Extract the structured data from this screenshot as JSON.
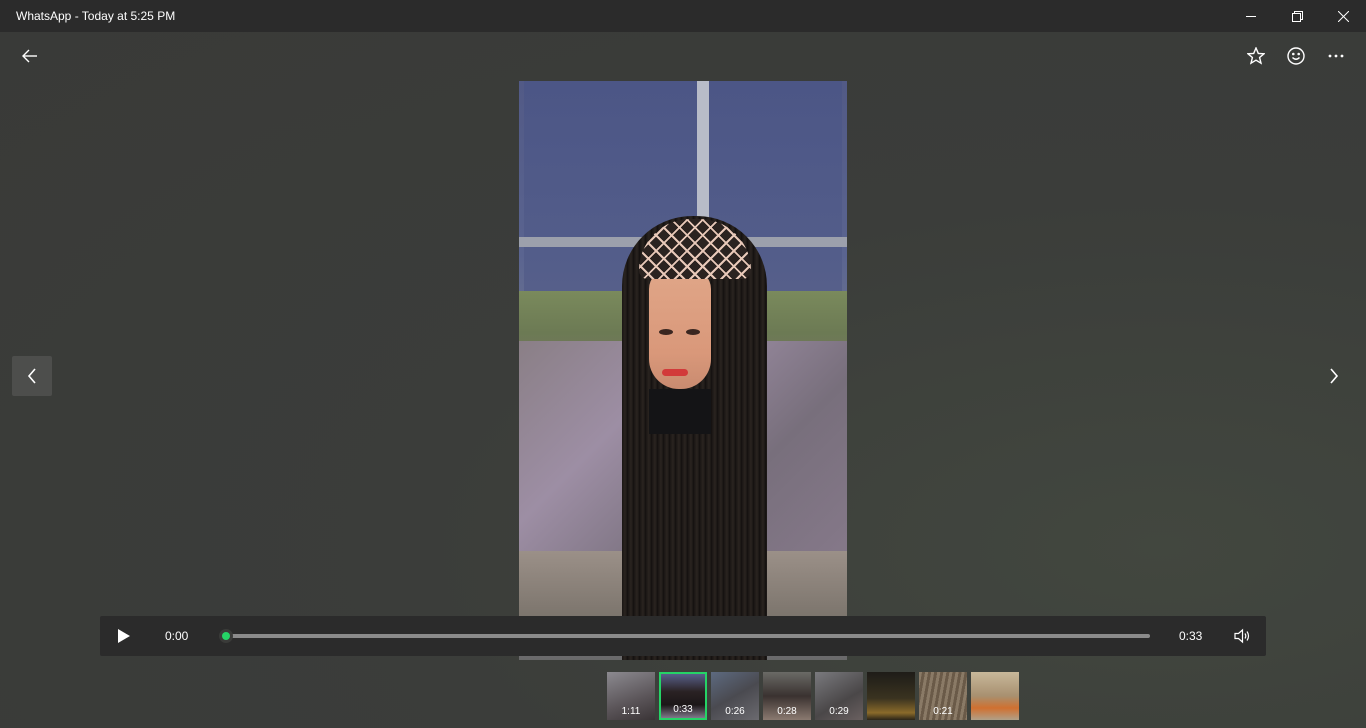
{
  "window": {
    "title": "WhatsApp - Today at 5:25 PM",
    "controls": [
      "minimize-icon",
      "restore-icon",
      "close-icon"
    ]
  },
  "toolbar": {
    "back_icon": "arrow-left-icon",
    "actions": [
      "star-icon",
      "emoji-icon",
      "more-icon"
    ]
  },
  "navigation": {
    "previous_icon": "chevron-left-icon",
    "next_icon": "chevron-right-icon"
  },
  "player": {
    "current_time": "0:00",
    "duration": "0:33",
    "progress": 0,
    "play_icon": "play-icon",
    "volume_icon": "volume-icon",
    "accent_color": "#25d366"
  },
  "thumbnails": [
    {
      "duration": "1:11",
      "active": false
    },
    {
      "duration": "0:33",
      "active": true
    },
    {
      "duration": "0:26",
      "active": false
    },
    {
      "duration": "0:28",
      "active": false
    },
    {
      "duration": "0:29",
      "active": false
    },
    {
      "duration": "",
      "active": false
    },
    {
      "duration": "0:21",
      "active": false
    },
    {
      "duration": "",
      "active": false
    }
  ]
}
